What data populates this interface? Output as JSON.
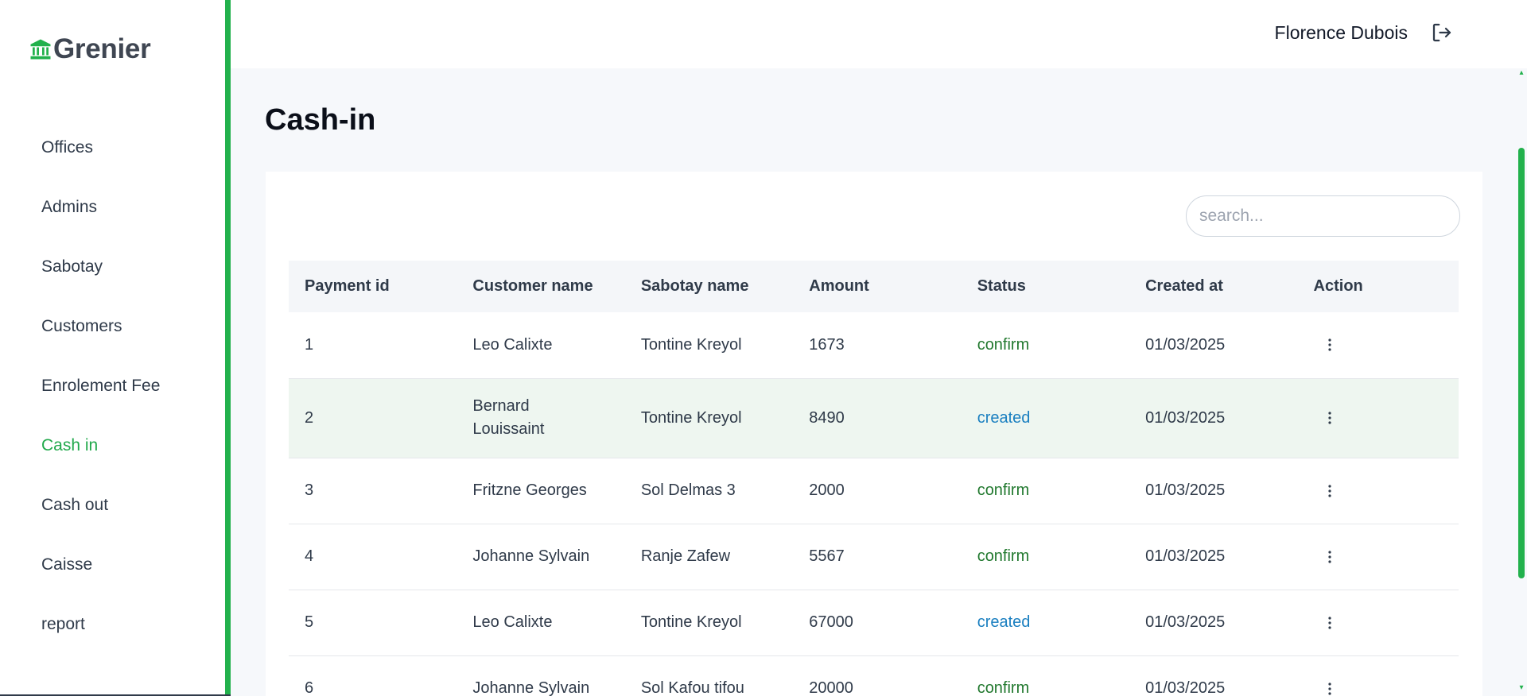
{
  "brand": {
    "name": "Grenier",
    "icon": "bank-icon",
    "color": "#22b14c"
  },
  "sidebar": {
    "items": [
      {
        "label": "Offices",
        "active": false
      },
      {
        "label": "Admins",
        "active": false
      },
      {
        "label": "Sabotay",
        "active": false
      },
      {
        "label": "Customers",
        "active": false
      },
      {
        "label": "Enrolement Fee",
        "active": false
      },
      {
        "label": "Cash in",
        "active": true
      },
      {
        "label": "Cash out",
        "active": false
      },
      {
        "label": "Caisse",
        "active": false
      },
      {
        "label": "report",
        "active": false
      }
    ]
  },
  "header": {
    "user_name": "Florence Dubois",
    "logout_icon": "logout-icon"
  },
  "main": {
    "title": "Cash-in",
    "search": {
      "placeholder": "search...",
      "value": ""
    },
    "table": {
      "columns": [
        "Payment id",
        "Customer name",
        "Sabotay name",
        "Amount",
        "Status",
        "Created at",
        "Action"
      ],
      "rows": [
        {
          "id": "1",
          "customer": "Leo Calixte",
          "sabotay": "Tontine Kreyol",
          "amount": "1673",
          "status": "confirm",
          "created": "01/03/2025"
        },
        {
          "id": "2",
          "customer": "Bernard Louissaint",
          "sabotay": "Tontine Kreyol",
          "amount": "8490",
          "status": "created",
          "created": "01/03/2025"
        },
        {
          "id": "3",
          "customer": "Fritzne Georges",
          "sabotay": "Sol Delmas 3",
          "amount": "2000",
          "status": "confirm",
          "created": "01/03/2025"
        },
        {
          "id": "4",
          "customer": "Johanne Sylvain",
          "sabotay": "Ranje Zafew",
          "amount": "5567",
          "status": "confirm",
          "created": "01/03/2025"
        },
        {
          "id": "5",
          "customer": "Leo Calixte",
          "sabotay": "Tontine Kreyol",
          "amount": "67000",
          "status": "created",
          "created": "01/03/2025"
        },
        {
          "id": "6",
          "customer": "Johanne Sylvain",
          "sabotay": "Sol Kafou tifou",
          "amount": "20000",
          "status": "confirm",
          "created": "01/03/2025"
        }
      ]
    }
  },
  "colors": {
    "accent": "#22b14c",
    "confirm": "#22792f",
    "created": "#1a7fc0"
  }
}
